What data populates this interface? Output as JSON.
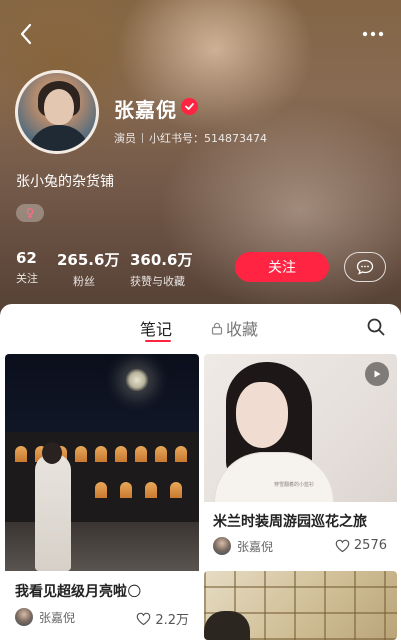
{
  "profile": {
    "name": "张嘉倪",
    "role": "演员",
    "redbook_id": "小红书号：514873474",
    "bio": "张小兔的杂货铺",
    "gender_symbol": "♀",
    "stats": [
      {
        "value": "62",
        "label": "关注"
      },
      {
        "value": "265.6万",
        "label": "粉丝"
      },
      {
        "value": "360.6万",
        "label": "获赞与收藏"
      }
    ],
    "follow_label": "关注"
  },
  "tabs": {
    "notes": "笔记",
    "collections": "收藏"
  },
  "notes": [
    {
      "title": "我看见超级月亮啦",
      "emoji": "🌕",
      "author": "张嘉倪",
      "likes": "2.2万"
    },
    {
      "title": "米兰时装周游园巡花之旅",
      "author": "张嘉倪",
      "likes": "2576",
      "is_video": true,
      "cover_caption": "穿雪翻着的小蓝衫"
    },
    {
      "title": ""
    }
  ],
  "colors": {
    "accent": "#ff2442",
    "panel": "#ffffff"
  },
  "icons": {
    "back": "chevron-left-icon",
    "more": "more-dots-icon",
    "verified": "verified-check-icon",
    "message": "chat-bubble-icon",
    "lock": "lock-icon",
    "search": "search-icon",
    "heart": "heart-icon",
    "play": "play-icon"
  }
}
